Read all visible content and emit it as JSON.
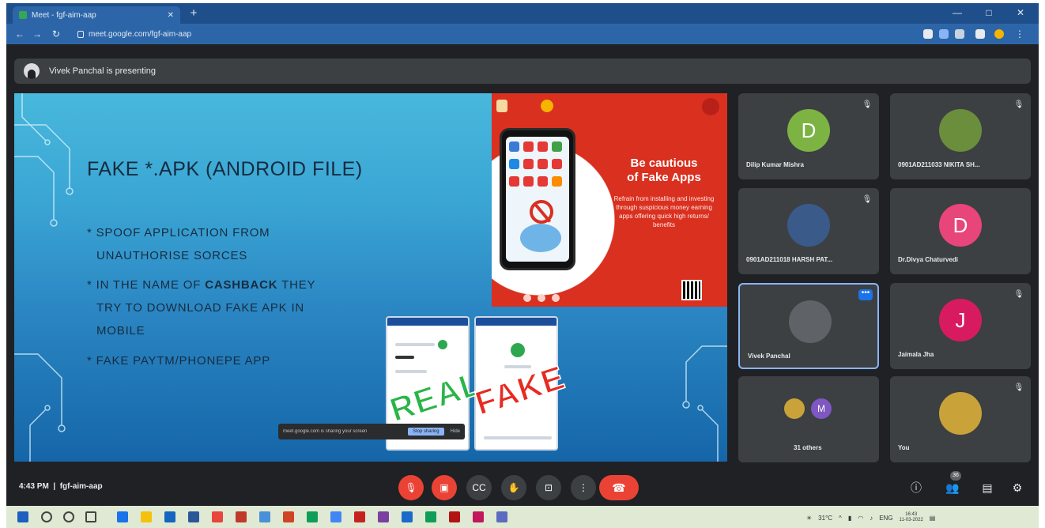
{
  "browser": {
    "tab_title": "Meet - fgf-aim-aap",
    "url": "meet.google.com/fgf-aim-aap"
  },
  "meet": {
    "presenting_text": "Vivek Panchal is presenting"
  },
  "slide": {
    "title": "FAKE *.APK (ANDROID FILE)",
    "bullets": [
      {
        "line1": "SPOOF APPLICATION FROM",
        "line2": "UNAUTHORISE  SORCES"
      },
      {
        "line1_pre": "IN THE NAME OF ",
        "line1_bold": "CASHBACK",
        "line1_post": " THEY",
        "line2": "TRY TO DOWNLOAD FAKE APK IN",
        "line3": "MOBILE"
      },
      {
        "line1": "FAKE PAYTM/PHONEPE APP"
      }
    ],
    "poster": {
      "heading_line1": "Be cautious",
      "heading_line2": "of Fake Apps",
      "body": "Refrain from installing and investing through suspicious money earning apps offering quick high returns/ benefits"
    },
    "real_label": "REAL",
    "fake_label": "FAKE",
    "share_popup": {
      "message": "meet.google.com is sharing your screen",
      "stop_label": "Stop sharing",
      "hide_label": "Hide"
    }
  },
  "participants": [
    {
      "name": "Dilip Kumar Mishra",
      "initial": "D",
      "color": "#7cb342",
      "photo": false
    },
    {
      "name": "0901AD211033 NIKITA SH...",
      "initial": "",
      "color": "#6b8e3d",
      "photo": true
    },
    {
      "name": "0901AD211018 HARSH PAT...",
      "initial": "",
      "color": "#3a5a8a",
      "photo": true
    },
    {
      "name": "Dr.Divya Chaturvedi",
      "initial": "D",
      "color": "#e8457a",
      "photo": false
    },
    {
      "name": "Vivek Panchal",
      "initial": "",
      "color": "#5f6368",
      "photo": true
    },
    {
      "name": "Jaimala Jha",
      "initial": "J",
      "color": "#d81b60",
      "photo": false
    },
    {
      "name": "31 others",
      "initial": "M",
      "color": "#7e57c2",
      "photo": false
    },
    {
      "name": "You",
      "initial": "",
      "color": "#c9a23a",
      "photo": true
    }
  ],
  "controls": {
    "time": "4:43 PM",
    "meeting_code": "fgf-aim-aap",
    "people_count": "36"
  },
  "taskbar": {
    "temperature": "31°C",
    "language": "ENG",
    "clock_time": "16:43",
    "clock_date": "11-03-2022"
  }
}
